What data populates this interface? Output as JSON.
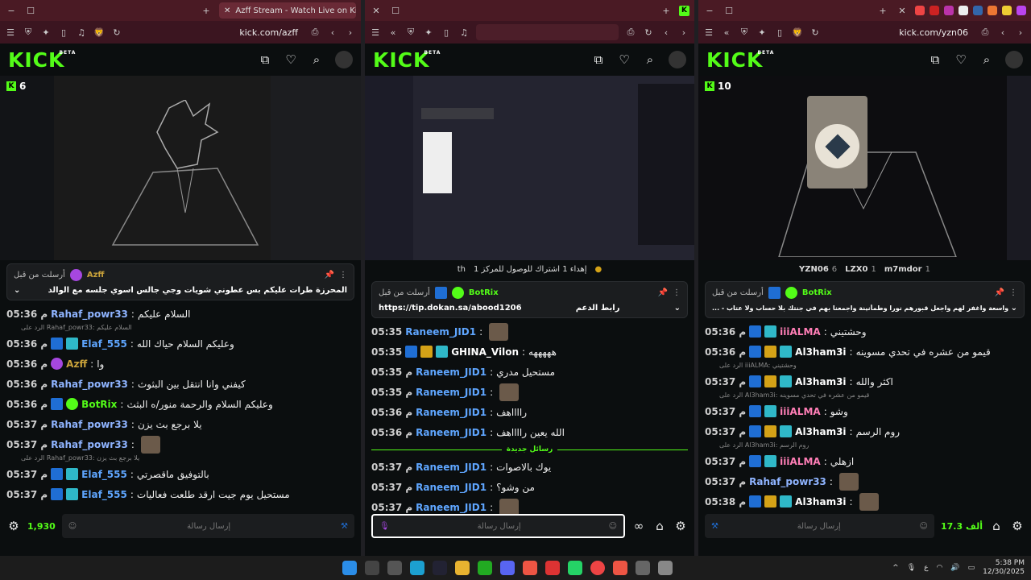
{
  "windows": [
    {
      "tab_title": "Azff Stream - Watch Live on Kick",
      "url": "kick.com/azff",
      "viewers": "6",
      "pinned": {
        "by_label": "أرسلت من قبل",
        "user": "Azff",
        "text": "المحرزة طرات عليكم بس عطوني شويات وجي جالس اسوي جلسه مع الوالد"
      },
      "messages": [
        {
          "time": "05:36 م",
          "user": "Rahaf_powr33",
          "text": "السلام عليكم",
          "color": "#8fb4ff"
        },
        {
          "reply": "الرد على Rahaf_powr33: السلام عليكم"
        },
        {
          "time": "05:36 م",
          "user": "Elaf_555",
          "text": "وعليكم السلام حياك الله",
          "color": "#5fa6ff",
          "badges": [
            "mod",
            "og"
          ]
        },
        {
          "time": "05:36 م",
          "user": "Azff",
          "text": "وا",
          "color": "#c9a23a",
          "badges": [
            "mic"
          ]
        },
        {
          "time": "05:36 م",
          "user": "Rahaf_powr33",
          "text": "كيفني وانا انتقل بين البثوث",
          "color": "#8fb4ff"
        },
        {
          "time": "05:36 م",
          "user": "BotRix",
          "text": "وعليكم السلام والرحمة منور/ه البثث",
          "color": "#53fc18",
          "badges": [
            "mod",
            "ver"
          ]
        },
        {
          "time": "05:37 م",
          "user": "Rahaf_powr33",
          "text": "يلا برجع بث يزن",
          "color": "#8fb4ff"
        },
        {
          "time": "05:37 م",
          "user": "Rahaf_powr33",
          "text": "",
          "color": "#8fb4ff",
          "emote": true
        },
        {
          "reply": "الرد على Rahaf_powr33: يلا برجع بث يزن"
        },
        {
          "time": "05:37 م",
          "user": "Elaf_555",
          "text": "بالتوفيق ماقصرتي",
          "color": "#5fa6ff",
          "badges": [
            "mod",
            "og"
          ]
        },
        {
          "time": "05:37 م",
          "user": "Elaf_555",
          "text": "مستحيل يوم جيت ارقد طلعت فعاليات",
          "color": "#5fa6ff",
          "badges": [
            "mod",
            "og"
          ]
        }
      ],
      "composer_placeholder": "إرسال رسالة",
      "count": "1,930"
    },
    {
      "url": "",
      "topbar_text": "إهداء 1 اشتراك للوصول للمركز 1",
      "topbar_suffix": "th",
      "pinned": {
        "by_label": "أرسلت من قبل",
        "user": "BotRix",
        "link": "https://tip.dokan.sa/abood1206",
        "text": "رابط الدعم"
      },
      "messages": [
        {
          "time": "05:35",
          "user": "Raneem_JID1",
          "text": "",
          "color": "#5fa6ff",
          "emote": true
        },
        {
          "time": "05:35",
          "user": "GHINA_Vilon",
          "text": "هههههه",
          "color": "#ffffff",
          "badges": [
            "mod",
            "crown",
            "og"
          ]
        },
        {
          "time": "05:35 م",
          "user": "Raneem_JID1",
          "text": "مستحيل مدري",
          "color": "#5fa6ff"
        },
        {
          "time": "05:35 م",
          "user": "Raneem_JID1",
          "text": "",
          "color": "#5fa6ff",
          "emote": true
        },
        {
          "time": "05:36 م",
          "user": "Raneem_JID1",
          "text": "رااااهف",
          "color": "#5fa6ff"
        },
        {
          "time": "05:36 م",
          "user": "Raneem_JID1",
          "text": "الله يعين رااااهف",
          "color": "#5fa6ff"
        }
      ],
      "divider": "رسائل جديدة",
      "messages_after": [
        {
          "time": "05:37 م",
          "user": "Raneem_JID1",
          "text": "يوك بالاصوات",
          "color": "#5fa6ff"
        },
        {
          "time": "05:37 م",
          "user": "Raneem_JID1",
          "text": "من وشو؟",
          "color": "#5fa6ff"
        },
        {
          "time": "05:37 م",
          "user": "Raneem_JID1",
          "text": "",
          "color": "#5fa6ff",
          "emote": true
        }
      ],
      "composer_placeholder": "إرسال رسالة"
    },
    {
      "url": "kick.com/yzn06",
      "viewers": "10",
      "gifters": [
        {
          "name": "YZN06",
          "n": "6"
        },
        {
          "name": "LZX0",
          "n": "1"
        },
        {
          "name": "m7mdor",
          "n": "1"
        }
      ],
      "pinned": {
        "by_label": "أرسلت من قبل",
        "user": "BotRix",
        "text": "... - اللهم ارحمهم رحمة واسعة واغفر لهم واجعل قبورهم نورا وطمأنينة واجمعنا بهم في جنتك بلا حساب ولا عتاب"
      },
      "messages": [
        {
          "time": "05:36 م",
          "user": "iiiALMA",
          "text": "وحشتيني",
          "color": "#ff7eb6",
          "badges": [
            "mod",
            "og"
          ]
        },
        {
          "time": "05:36 م",
          "user": "Al3ham3i",
          "text": "قيمو من عشره في تحدي مسوينه",
          "color": "#ffffff",
          "badges": [
            "mod",
            "crown",
            "og"
          ]
        },
        {
          "reply": "الرد على iiiALMA: وحشتيني"
        },
        {
          "time": "05:37 م",
          "user": "Al3ham3i",
          "text": "اكثر والله",
          "color": "#ffffff",
          "badges": [
            "mod",
            "crown",
            "og"
          ]
        },
        {
          "reply": "الرد على Al3ham3i: قيمو من عشره في تحدي مسوينه"
        },
        {
          "time": "05:37 م",
          "user": "iiiALMA",
          "text": "وشو",
          "color": "#ff7eb6",
          "badges": [
            "mod",
            "og"
          ]
        },
        {
          "time": "05:37 م",
          "user": "Al3ham3i",
          "text": "روم الرسم",
          "color": "#ffffff",
          "badges": [
            "mod",
            "crown",
            "og"
          ]
        },
        {
          "reply": "الرد على Al3ham3i: روم الرسم"
        },
        {
          "time": "05:37 م",
          "user": "iiiALMA",
          "text": "ازهلي",
          "color": "#ff7eb6",
          "badges": [
            "mod",
            "og"
          ]
        },
        {
          "time": "05:37 م",
          "user": "Rahaf_powr33",
          "text": "",
          "color": "#8fb4ff",
          "emote": true
        },
        {
          "time": "05:38 م",
          "user": "Al3ham3i",
          "text": "",
          "color": "#ffffff",
          "badges": [
            "mod",
            "crown",
            "og"
          ],
          "emote": true
        }
      ],
      "composer_placeholder": "إرسال رسالة",
      "count": "17.3 ألف"
    }
  ],
  "taskbar": {
    "time": "5:38 PM",
    "date": "12/30/2025",
    "lang": "ع"
  },
  "colors": {
    "kick_green": "#53fc18",
    "titlebar": "#4a1a24"
  }
}
